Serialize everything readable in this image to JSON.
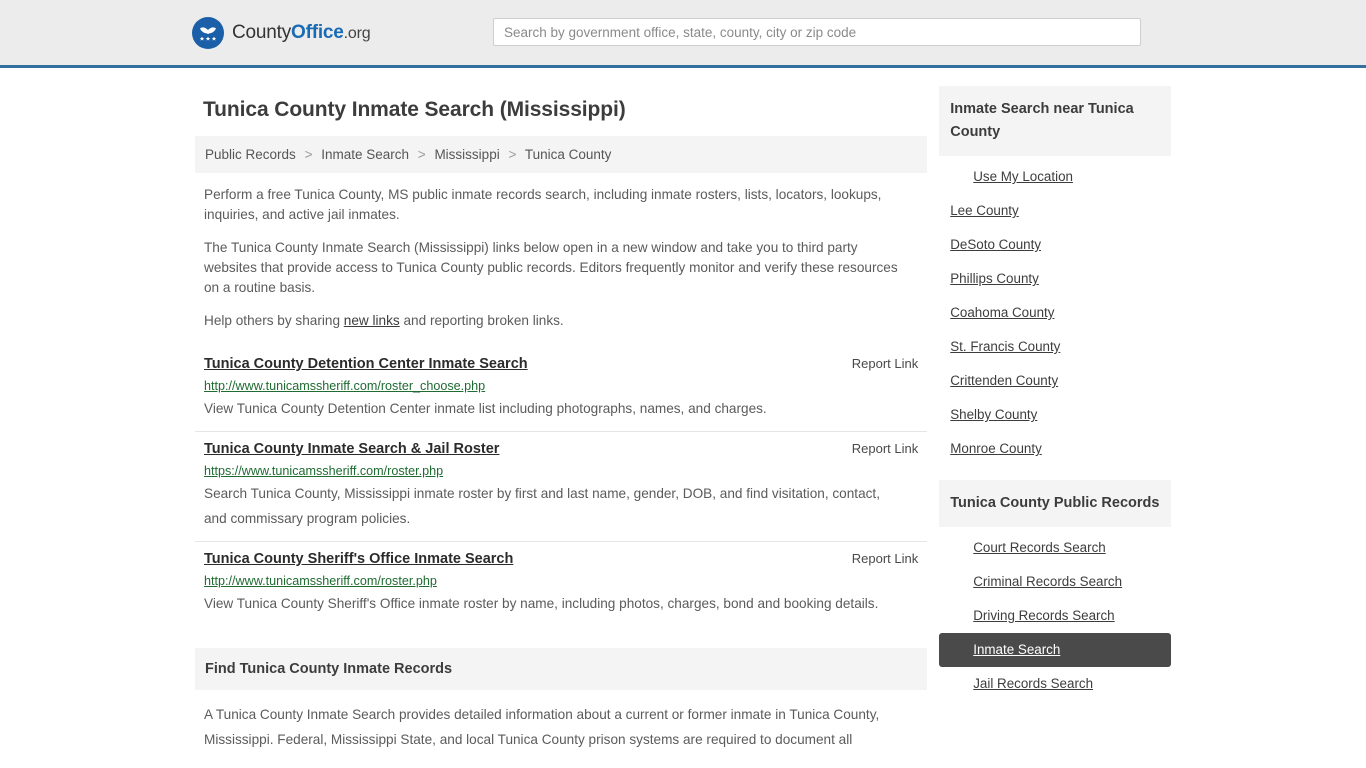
{
  "header": {
    "logo_icon": "county-office-eagle-logo",
    "brand_part1": "County",
    "brand_part2": "Office",
    "brand_part3": ".org",
    "search": {
      "placeholder": "Search by government office, state, county, city or zip code",
      "value": ""
    }
  },
  "page": {
    "title": "Tunica County Inmate Search (Mississippi)"
  },
  "breadcrumb": {
    "separator": ">",
    "items": [
      {
        "label": "Public Records"
      },
      {
        "label": "Inmate Search"
      },
      {
        "label": "Mississippi"
      },
      {
        "label": "Tunica County"
      }
    ]
  },
  "intro": {
    "p1": "Perform a free Tunica County, MS public inmate records search, including inmate rosters, lists, locators, lookups, inquiries, and active jail inmates.",
    "p2": "The Tunica County Inmate Search (Mississippi) links below open in a new window and take you to third party websites that provide access to Tunica County public records. Editors frequently monitor and verify these resources on a routine basis.",
    "p3_before": "Help others by sharing ",
    "p3_link": "new links",
    "p3_after": " and reporting broken links."
  },
  "results": {
    "report_label": "Report Link",
    "items": [
      {
        "title": "Tunica County Detention Center Inmate Search",
        "url": "http://www.tunicamssheriff.com/roster_choose.php",
        "description": "View Tunica County Detention Center inmate list including photographs, names, and charges."
      },
      {
        "title": "Tunica County Inmate Search & Jail Roster",
        "url": "https://www.tunicamssheriff.com/roster.php",
        "description": "Search Tunica County, Mississippi inmate roster by first and last name, gender, DOB, and find visitation, contact, and commissary program policies."
      },
      {
        "title": "Tunica County Sheriff's Office Inmate Search",
        "url": "http://www.tunicamssheriff.com/roster.php",
        "description": "View Tunica County Sheriff's Office inmate roster by name, including photos, charges, bond and booking details."
      }
    ]
  },
  "find_section": {
    "heading": "Find Tunica County Inmate Records",
    "body": "A Tunica County Inmate Search provides detailed information about a current or former inmate in Tunica County, Mississippi. Federal, Mississippi State, and local Tunica County prison systems are required to document all"
  },
  "sidebar": {
    "nearby": {
      "heading": "Inmate Search near Tunica County",
      "items": [
        {
          "label": "Use My Location",
          "indent": true,
          "active": false
        },
        {
          "label": "Lee County",
          "indent": false,
          "active": false
        },
        {
          "label": "DeSoto County",
          "indent": false,
          "active": false
        },
        {
          "label": "Phillips County",
          "indent": false,
          "active": false
        },
        {
          "label": "Coahoma County",
          "indent": false,
          "active": false
        },
        {
          "label": "St. Francis County",
          "indent": false,
          "active": false
        },
        {
          "label": "Crittenden County",
          "indent": false,
          "active": false
        },
        {
          "label": "Shelby County",
          "indent": false,
          "active": false
        },
        {
          "label": "Monroe County",
          "indent": false,
          "active": false
        }
      ]
    },
    "public_records": {
      "heading": "Tunica County Public Records",
      "items": [
        {
          "label": "Court Records Search",
          "indent": true,
          "active": false
        },
        {
          "label": "Criminal Records Search",
          "indent": true,
          "active": false
        },
        {
          "label": "Driving Records Search",
          "indent": true,
          "active": false
        },
        {
          "label": "Inmate Search",
          "indent": true,
          "active": true
        },
        {
          "label": "Jail Records Search",
          "indent": true,
          "active": false
        }
      ]
    }
  },
  "colors": {
    "header_bg": "#ececec",
    "header_border": "#33709e",
    "brand_blue": "#1a6bb5",
    "url_green": "#1f6b32",
    "panel_gray": "#f4f4f4",
    "active_bg": "#4a4a4a",
    "body_text": "#5b5b5b"
  }
}
